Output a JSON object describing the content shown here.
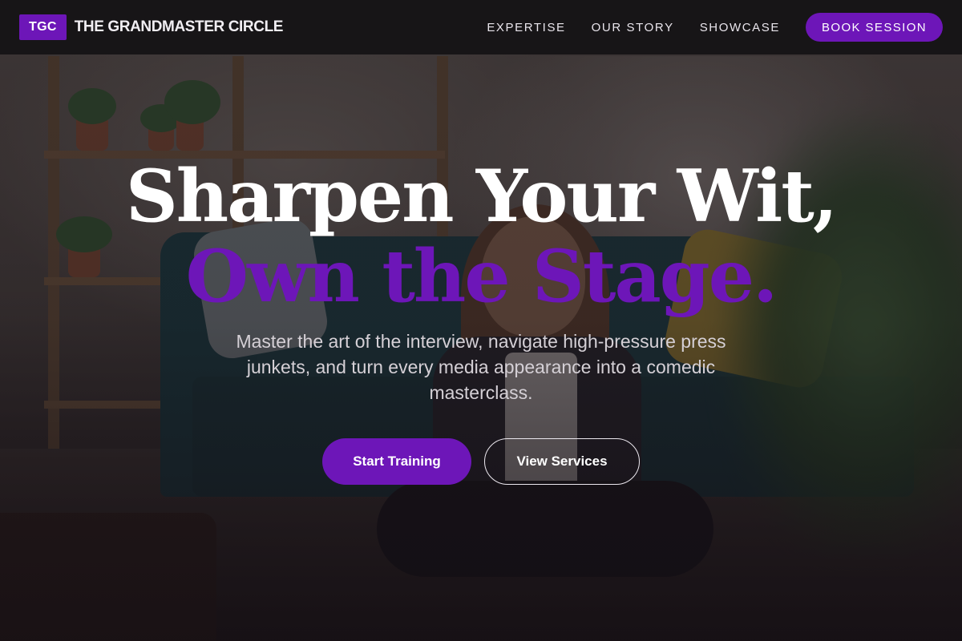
{
  "header": {
    "logo_badge": "TGC",
    "brand_name": "THE GRANDMASTER CIRCLE",
    "nav": [
      {
        "label": "EXPERTISE"
      },
      {
        "label": "OUR STORY"
      },
      {
        "label": "SHOWCASE"
      }
    ],
    "cta_label": "BOOK SESSION"
  },
  "hero": {
    "headline": "Sharpen Your Wit,",
    "headline_accent": "Own the Stage.",
    "subtext": "Master the art of the interview, navigate high-pressure press junkets, and turn every media appearance into a comedic masterclass.",
    "primary_button": "Start Training",
    "secondary_button": "View Services",
    "background_image": "woman-sitting-on-floor-recording-video-living-room"
  },
  "colors": {
    "accent": "#6d16b8",
    "navbar_bg": "#161416",
    "headline_text": "#ffffff",
    "subtext": "#d5d0d6"
  }
}
